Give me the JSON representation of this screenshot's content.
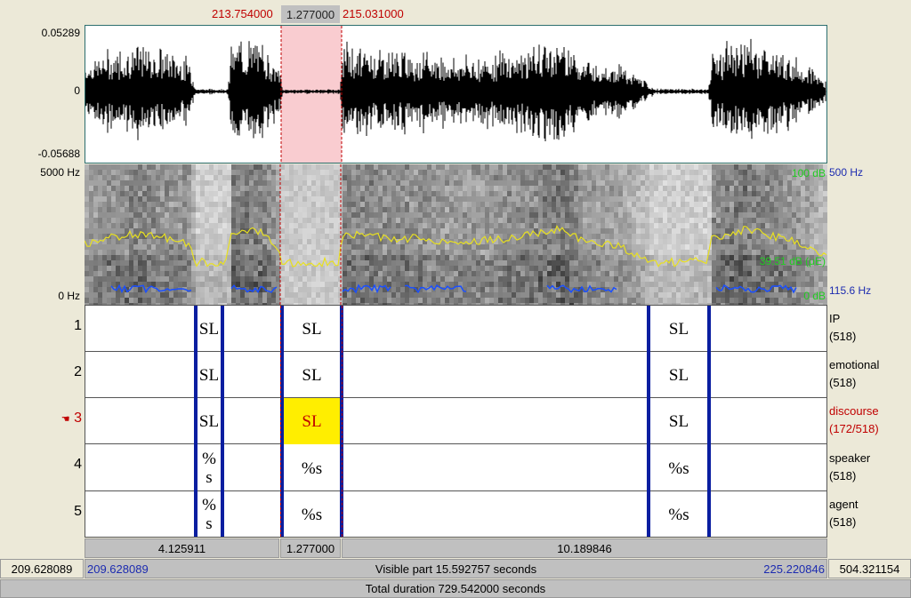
{
  "selection": {
    "start": "213.754000",
    "duration": "1.277000",
    "end": "215.031000"
  },
  "waveform": {
    "y_max": "0.05289",
    "y_zero": "0",
    "y_min": "-0.05688"
  },
  "spectrogram": {
    "freq_max": "5000 Hz",
    "freq_min": "0 Hz",
    "pitch_max": "500 Hz",
    "pitch_min": "115.6 Hz",
    "intensity_max": "100 dB",
    "intensity_cursor": "39.51 dB (μE)",
    "intensity_min": "0 dB"
  },
  "tiers": [
    {
      "num": "1",
      "name": "IP",
      "count": "(518)",
      "intervals": [
        "SL",
        "SL",
        "SL"
      ]
    },
    {
      "num": "2",
      "name": "emotional",
      "count": "(518)",
      "intervals": [
        "SL",
        "SL",
        "SL"
      ]
    },
    {
      "num": "3",
      "name": "discourse",
      "count": "(172/518)",
      "intervals": [
        "SL",
        "SL",
        "SL"
      ],
      "active": true,
      "pointer_icon": "hand-pointer-icon"
    },
    {
      "num": "4",
      "name": "speaker",
      "count": "(518)",
      "intervals": [
        "%\ns",
        "%s",
        "%s"
      ]
    },
    {
      "num": "5",
      "name": "agent",
      "count": "(518)",
      "intervals": [
        "%\ns",
        "%s",
        "%s"
      ]
    }
  ],
  "durations": {
    "before": "4.125911",
    "selection": "1.277000",
    "after": "10.189846"
  },
  "window": {
    "total_start": "209.628089",
    "visible_start": "209.628089",
    "visible_label": "Visible part 15.592757 seconds",
    "visible_end": "225.220846",
    "total_end": "504.321154",
    "total_label": "Total duration 729.542000 seconds"
  },
  "colors": {
    "selection_pink": "#f9ccd0",
    "boundary_blue": "#0a1ea0",
    "active_red": "#c00000",
    "highlight_yellow": "#ffee00",
    "intensity_yellow": "#e8e020",
    "pitch_blue": "#1a4fff"
  }
}
